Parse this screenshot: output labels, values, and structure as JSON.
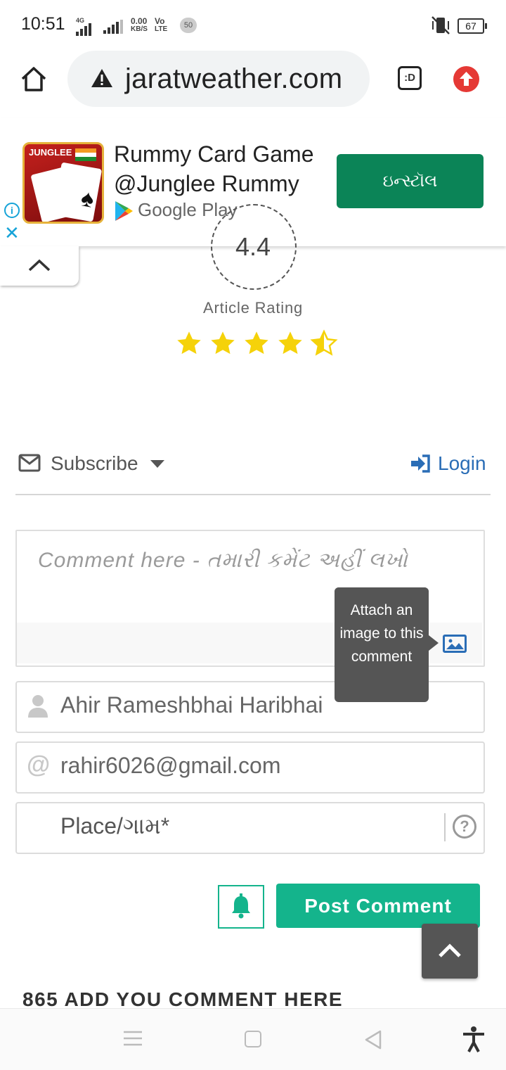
{
  "status_bar": {
    "time": "10:51",
    "network_4g": "4G",
    "speed_value": "0.00",
    "speed_unit": "KB/S",
    "volte_top": "Vo",
    "volte_bottom": "LTE",
    "notif_count": "50",
    "battery": "67"
  },
  "browser": {
    "url": "jaratweather.com",
    "home_icon": "home-icon",
    "warning_icon": "warning-icon",
    "tab_icon_label": ":D",
    "update_icon": "upload-arrow-icon"
  },
  "ad": {
    "app_logo_text": "JUNGLEE",
    "title_line1": "Rummy Card Game",
    "title_line2": "@Junglee Rummy",
    "store": "Google Play",
    "install_label": "ઇન્સ્ટૉલ",
    "install_color": "#0b8457"
  },
  "rating": {
    "value": "4.4",
    "label": "Article Rating",
    "stars": 4.5,
    "star_color": "#f5d20a"
  },
  "subscribe": {
    "subscribe_label": "Subscribe",
    "login_label": "Login",
    "login_color": "#2a6db6"
  },
  "comment_form": {
    "comment_placeholder": "Comment here - તમારી કમેંટ અહીં લખો",
    "tooltip_text": "Attach an image to this comment",
    "name_value": "Ahir Rameshbhai Haribhai",
    "email_value": "rahir6026@gmail.com",
    "place_placeholder": "Place/ગામ*",
    "post_label": "Post Comment",
    "accent_color": "#14b48c"
  },
  "comments": {
    "heading": "865 ADD YOU COMMENT HERE"
  }
}
